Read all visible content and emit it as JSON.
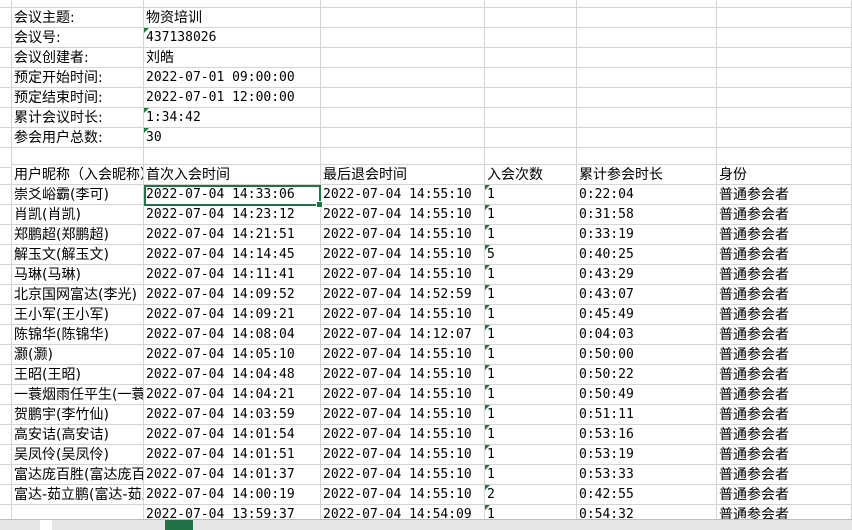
{
  "meta": {
    "topic_label": "会议主题:",
    "topic_value": "物资培训",
    "id_label": "会议号:",
    "id_value": "437138026",
    "creator_label": "会议创建者:",
    "creator_value": "刘皓",
    "start_label": "预定开始时间:",
    "start_value": "2022-07-01 09:00:00",
    "end_label": "预定结束时间:",
    "end_value": "2022-07-01 12:00:00",
    "duration_label": "累计会议时长:",
    "duration_value": "1:34:42",
    "users_label": "参会用户总数:",
    "users_value": "30"
  },
  "table": {
    "headers": [
      "用户昵称（入会昵称）",
      "首次入会时间",
      "最后退会时间",
      "入会次数",
      "累计参会时长",
      "身份"
    ],
    "rows": [
      [
        "崇爻峪霸(李可)",
        "2022-07-04 14:33:06",
        "2022-07-04 14:55:10",
        "1",
        "0:22:04",
        "普通参会者"
      ],
      [
        "肖凯(肖凯)",
        "2022-07-04 14:23:12",
        "2022-07-04 14:55:10",
        "1",
        "0:31:58",
        "普通参会者"
      ],
      [
        "郑鹏超(郑鹏超)",
        "2022-07-04 14:21:51",
        "2022-07-04 14:55:10",
        "1",
        "0:33:19",
        "普通参会者"
      ],
      [
        "解玉文(解玉文)",
        "2022-07-04 14:14:45",
        "2022-07-04 14:55:10",
        "5",
        "0:40:25",
        "普通参会者"
      ],
      [
        "马琳(马琳)",
        "2022-07-04 14:11:41",
        "2022-07-04 14:55:10",
        "1",
        "0:43:29",
        "普通参会者"
      ],
      [
        "北京国网富达(李光)",
        "2022-07-04 14:09:52",
        "2022-07-04 14:52:59",
        "1",
        "0:43:07",
        "普通参会者"
      ],
      [
        "王小军(王小军)",
        "2022-07-04 14:09:21",
        "2022-07-04 14:55:10",
        "1",
        "0:45:49",
        "普通参会者"
      ],
      [
        "陈锦华(陈锦华)",
        "2022-07-04 14:08:04",
        "2022-07-04 14:12:07",
        "1",
        "0:04:03",
        "普通参会者"
      ],
      [
        "灏(灏)",
        "2022-07-04 14:05:10",
        "2022-07-04 14:55:10",
        "1",
        "0:50:00",
        "普通参会者"
      ],
      [
        "王昭(王昭)",
        "2022-07-04 14:04:48",
        "2022-07-04 14:55:10",
        "1",
        "0:50:22",
        "普通参会者"
      ],
      [
        "一蓑烟雨任平生(一蓑烟雨任平生)",
        "2022-07-04 14:04:21",
        "2022-07-04 14:55:10",
        "1",
        "0:50:49",
        "普通参会者"
      ],
      [
        "贺鹏宇(李竹仙)",
        "2022-07-04 14:03:59",
        "2022-07-04 14:55:10",
        "1",
        "0:51:11",
        "普通参会者"
      ],
      [
        "高安诘(高安诘)",
        "2022-07-04 14:01:54",
        "2022-07-04 14:55:10",
        "1",
        "0:53:16",
        "普通参会者"
      ],
      [
        "吴凤伶(吴凤伶)",
        "2022-07-04 14:01:51",
        "2022-07-04 14:55:10",
        "1",
        "0:53:19",
        "普通参会者"
      ],
      [
        "富达庞百胜(富达庞百胜)",
        "2022-07-04 14:01:37",
        "2022-07-04 14:55:10",
        "1",
        "0:53:33",
        "普通参会者"
      ],
      [
        "富达-茹立鹏(富达-茹立鹏)",
        "2022-07-04 14:00:19",
        "2022-07-04 14:55:10",
        "2",
        "0:42:55",
        "普通参会者"
      ],
      [
        "",
        "2022-07-04 13:59:37",
        "2022-07-04 14:54:09",
        "1",
        "0:54:32",
        "普通参会者"
      ]
    ]
  },
  "colors": {
    "grid": "#d4d4d4",
    "accent": "#217346",
    "comment_flag": "#1e7b34"
  }
}
